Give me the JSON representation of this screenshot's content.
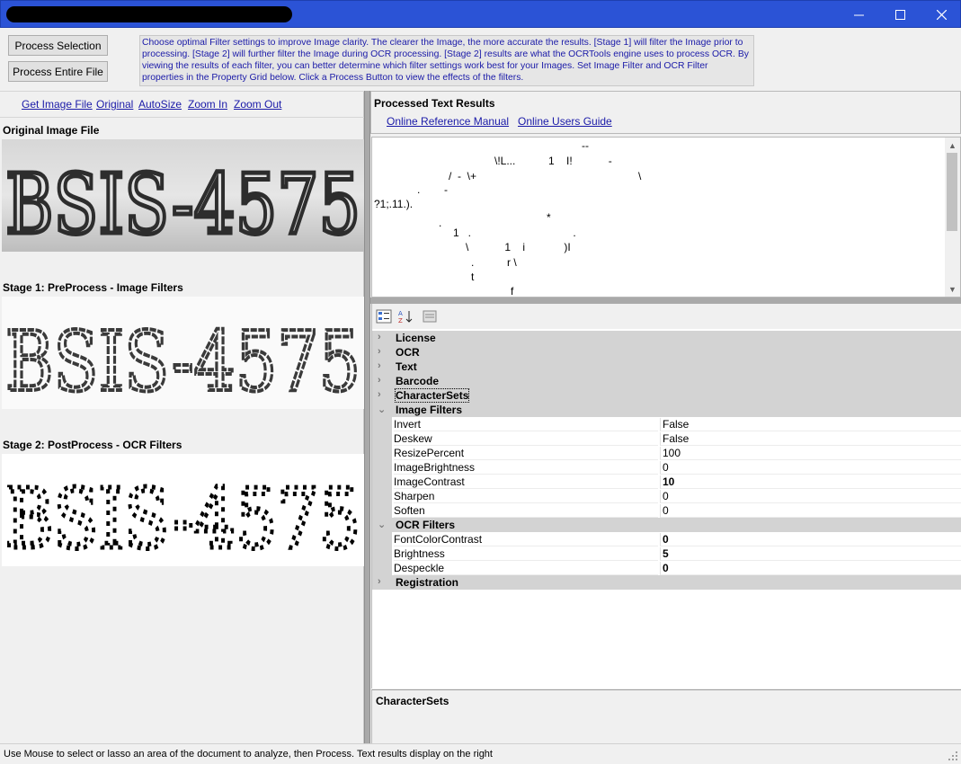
{
  "window": {
    "minimize": "—",
    "maximize": "☐",
    "close": "✕"
  },
  "toolbar": {
    "process_selection": "Process Selection",
    "process_entire_file": "Process Entire File",
    "info": "Choose optimal Filter settings to improve Image clarity. The clearer the Image, the more accurate the results. [Stage 1] will filter the Image prior to processing. [Stage 2] will further filter the Image during OCR processing.  [Stage 2] results are what the OCRTools engine uses to process OCR. By viewing the results of each filter, you can better determine which filter settings work best for your Images. Set Image Filter and OCR Filter properties in the Property Grid below. Click a Process Button to view the effects of the filters."
  },
  "left": {
    "links": [
      "Get Image File",
      "Original",
      "AutoSize",
      "Zoom In",
      "Zoom Out"
    ],
    "original_label": "Original Image File",
    "stage1_label": "Stage 1: PreProcess -  Image Filters",
    "stage2_label": "Stage 2: PostProcess - OCR Filters",
    "image_text": "BSIS-4575"
  },
  "results": {
    "title": "Processed Text Results",
    "links": [
      "Online Reference Manual",
      "Online Users Guide"
    ],
    "lines": [
      "--",
      "\\!L...           1    I!            -",
      "/  -  \\+                                                      \\",
      ".        -",
      "?1;.11.).",
      "*",
      ".",
      "1   .                                  .",
      "\\            1    i             )I",
      ".           r \\",
      "t",
      "f"
    ]
  },
  "propertygrid": {
    "categories_collapsed_top": [
      "License",
      "OCR",
      "Text",
      "Barcode",
      "CharacterSets"
    ],
    "image_filters": {
      "label": "Image Filters",
      "items": [
        {
          "name": "Invert",
          "value": "False",
          "bold": false
        },
        {
          "name": "Deskew",
          "value": "False",
          "bold": false
        },
        {
          "name": "ResizePercent",
          "value": "100",
          "bold": false
        },
        {
          "name": "ImageBrightness",
          "value": "0",
          "bold": false
        },
        {
          "name": "ImageContrast",
          "value": "10",
          "bold": true
        },
        {
          "name": "Sharpen",
          "value": "0",
          "bold": false
        },
        {
          "name": "Soften",
          "value": "0",
          "bold": false
        }
      ]
    },
    "ocr_filters": {
      "label": "OCR Filters",
      "items": [
        {
          "name": "FontColorContrast",
          "value": "0",
          "bold": true
        },
        {
          "name": "Brightness",
          "value": "5",
          "bold": true
        },
        {
          "name": "Despeckle",
          "value": "0",
          "bold": true
        }
      ]
    },
    "registration_label": "Registration",
    "description_title": "CharacterSets"
  },
  "status": {
    "text": "Use Mouse to select or lasso an area of the document to analyze, then Process.  Text results display on the right"
  }
}
